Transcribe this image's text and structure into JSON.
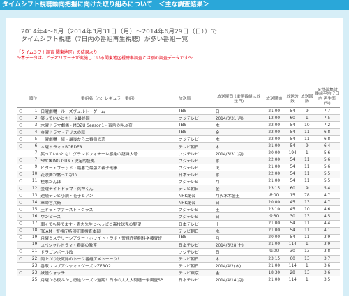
{
  "header": {
    "title": "タイムシフト視聴動向把握に向けた取り組みについて　＜主な調査結果＞"
  },
  "main": {
    "title_line1": "2014年4～6月（2014年3月31日（月）～2014年6月29日（日））で",
    "title_line2": "タイムシフト視聴（7日内の番組再生視聴）が多い番組一覧",
    "note_line1": "「タイムシフト調査 関東地区」の結果より",
    "note_line2": "～本データは、ビデオリサーチが実施している関東地区視聴率調査とは別の調査データです～",
    "footnote": "※世帯集計"
  },
  "table": {
    "headers": {
      "rank": "順位",
      "program": "番組名（○：レギュラー番組）",
      "station": "放送局",
      "date": "放送曜日 (単発番組は放送日)",
      "time": "放送開始",
      "minutes": "放送分数",
      "count": "放送回数",
      "avg": "番組平均 7日内 再生率(%)"
    },
    "rows": [
      {
        "circ": "○",
        "rank": "1",
        "program": "日曜劇場・ルーズヴェルト・ゲーム",
        "station": "TBS",
        "date": "日",
        "time": "21:00",
        "min": "54",
        "cnt": "9",
        "avg": "7.7"
      },
      {
        "circ": "○",
        "rank": "2",
        "program": "笑っていいとも！ ※最終回",
        "station": "フジテレビ",
        "date": "2014/3/31(月)",
        "time": "12:00",
        "min": "60",
        "cnt": "1",
        "avg": "7.5"
      },
      {
        "circ": "○",
        "rank": "3",
        "program": "木曜ドラマ劇場・MOZU Season1・百舌の叫ぶ夜",
        "station": "TBS",
        "date": "木",
        "time": "22:00",
        "min": "54",
        "cnt": "10",
        "avg": "7.2"
      },
      {
        "circ": "○",
        "rank": "4",
        "program": "金曜ドラマ・アリスの棘",
        "station": "TBS",
        "date": "金",
        "time": "22:00",
        "min": "54",
        "cnt": "11",
        "avg": "6.8"
      },
      {
        "circ": "○",
        "rank": "5",
        "program": "土曜劇場・続・最後から二番目の恋",
        "station": "フジテレビ",
        "date": "木",
        "time": "22:00",
        "min": "54",
        "cnt": "11",
        "avg": "6.8"
      },
      {
        "circ": "○",
        "rank": "6",
        "program": "木曜ドラマ・BORDER",
        "station": "テレビ朝日",
        "date": "木",
        "time": "21:00",
        "min": "54",
        "cnt": "9",
        "avg": "6.4"
      },
      {
        "circ": "",
        "rank": "7",
        "program": "笑っていいとも！グランドフィナーレ感謝の超特大号",
        "station": "フジテレビ",
        "date": "2014/3/31(月)",
        "time": "20:00",
        "min": "194",
        "cnt": "1",
        "avg": "5.6"
      },
      {
        "circ": "○",
        "rank": "7",
        "program": "SMOKING GUN・決定的証拠",
        "station": "フジテレビ",
        "date": "水",
        "time": "22:00",
        "min": "54",
        "cnt": "11",
        "avg": "5.6"
      },
      {
        "circ": "○",
        "rank": "9",
        "program": "ビター・ブラッド・最悪で最強の親子刑事",
        "station": "フジテレビ",
        "date": "火",
        "time": "21:00",
        "min": "54",
        "cnt": "11",
        "avg": "5.6"
      },
      {
        "circ": "○",
        "rank": "10",
        "program": "花咲舞が黙ってない",
        "station": "日本テレビ",
        "date": "水",
        "time": "22:00",
        "min": "54",
        "cnt": "11",
        "avg": "5.5"
      },
      {
        "circ": "○",
        "rank": "11",
        "program": "極悪がんぼ",
        "station": "フジテレビ",
        "date": "月",
        "time": "21:00",
        "min": "54",
        "cnt": "11",
        "avg": "5.5"
      },
      {
        "circ": "○",
        "rank": "12",
        "program": "金曜ナイトドラマ・死神くん",
        "station": "テレビ朝日",
        "date": "金",
        "time": "23:15",
        "min": "60",
        "cnt": "9",
        "avg": "5.4"
      },
      {
        "circ": "○",
        "rank": "13",
        "program": "連続テレビ小説・花子とアン",
        "station": "NHK総合",
        "date": "月火水木金土",
        "time": "8:00",
        "min": "15",
        "cnt": "78",
        "avg": "4.7"
      },
      {
        "circ": "○",
        "rank": "14",
        "program": "軍師官兵衛",
        "station": "NHK総合",
        "date": "日",
        "time": "20:00",
        "min": "45",
        "cnt": "13",
        "avg": "4.7"
      },
      {
        "circ": "○",
        "rank": "15",
        "program": "土ドラ・ファースト・クラス",
        "station": "フジテレビ",
        "date": "土",
        "time": "23:10",
        "min": "45",
        "cnt": "10",
        "avg": "4.6"
      },
      {
        "circ": "○",
        "rank": "16",
        "program": "ワンピース",
        "station": "フジテレビ",
        "date": "日",
        "time": "9:30",
        "min": "30",
        "cnt": "13",
        "avg": "4.5"
      },
      {
        "circ": "○",
        "rank": "17",
        "program": "弱くても勝てます・青志先生とへっぽこ高校球児の野望",
        "station": "日本テレビ",
        "date": "土",
        "time": "21:00",
        "min": "54",
        "cnt": "11",
        "avg": "4.4"
      },
      {
        "circ": "○",
        "rank": "18",
        "program": "TEAM・警視庁特別犯罪捜査本部",
        "station": "テレビ朝日",
        "date": "水",
        "time": "21:00",
        "min": "54",
        "cnt": "11",
        "avg": "4.1"
      },
      {
        "circ": "○",
        "rank": "19",
        "program": "月曜ミステリーシアター・ホワイト・ラボ・警視庁特別科学捜査班",
        "station": "TBS",
        "date": "月",
        "time": "20:00",
        "min": "54",
        "cnt": "11",
        "avg": "3.9"
      },
      {
        "circ": "",
        "rank": "19",
        "program": "スペシャルドラマ・春部の教室",
        "station": "日本テレビ",
        "date": "2014/6/28(土)",
        "time": "21:00",
        "min": "114",
        "cnt": "1",
        "avg": "3.9"
      },
      {
        "circ": "○",
        "rank": "21",
        "program": "ドラゴンボール改",
        "station": "フジテレビ",
        "date": "日",
        "time": "9:00",
        "min": "30",
        "cnt": "13",
        "avg": "3.8"
      },
      {
        "circ": "○",
        "rank": "22",
        "program": "同上がり決死隊のトーク番組アメトーーク！",
        "station": "テレビ朝日",
        "date": "木",
        "time": "23:15",
        "min": "60",
        "cnt": "13",
        "avg": "3.7"
      },
      {
        "circ": "",
        "rank": "23",
        "program": "香取フレブアシヤマ・グーズンZERO2",
        "station": "テレビ朝日",
        "date": "2014/4/2(水)",
        "time": "21:00",
        "min": "114",
        "cnt": "1",
        "avg": "3.6"
      },
      {
        "circ": "○",
        "rank": "23",
        "program": "妖怪ウォッチ",
        "station": "テレビ東京",
        "date": "金",
        "time": "18:30",
        "min": "28",
        "cnt": "13",
        "avg": "3.6"
      },
      {
        "circ": "",
        "rank": "25",
        "program": "月曜から夜ふかし行進シーズン進期！日本の大大大問題一挙調査SP",
        "station": "日本テレビ",
        "date": "2014/4/14(月)",
        "time": "21:00",
        "min": "114",
        "cnt": "1",
        "avg": "3.5"
      }
    ]
  }
}
